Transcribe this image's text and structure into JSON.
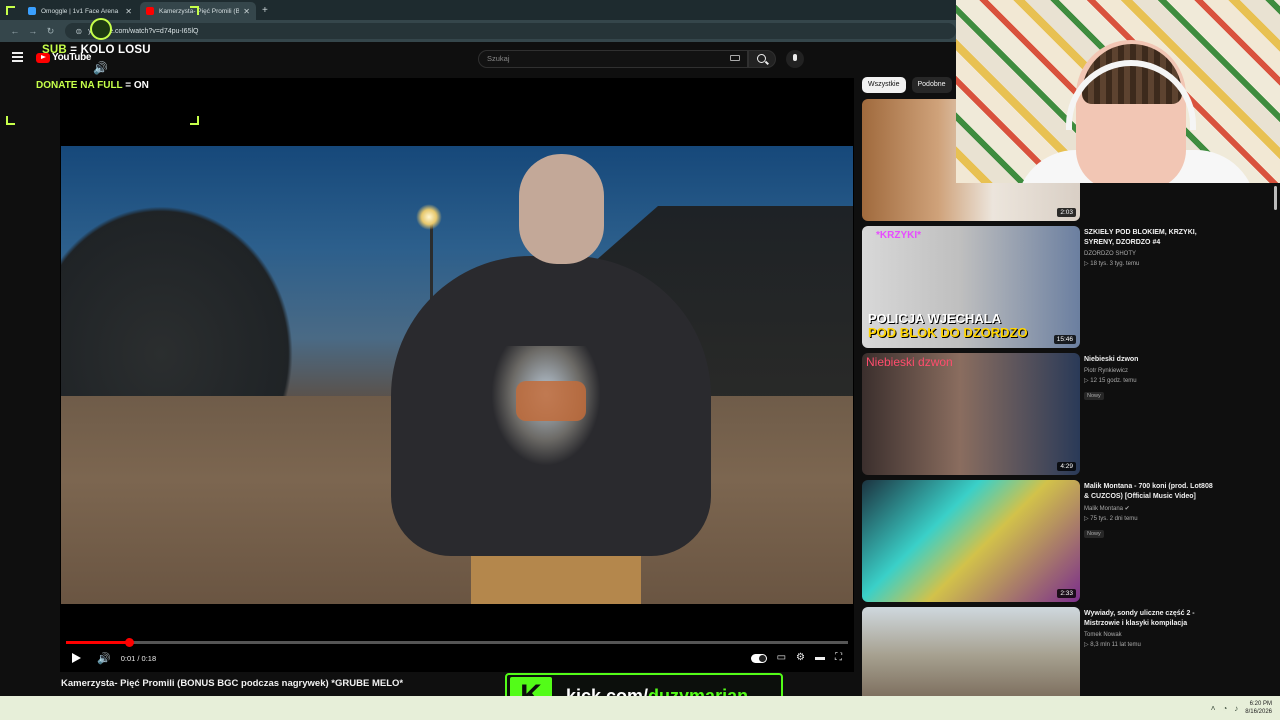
{
  "browser": {
    "tabs": [
      {
        "title": "Omoggle | 1v1 Face Arena",
        "icon": "omoggle-icon",
        "color": "#3aa0ff",
        "active": false
      },
      {
        "title": "Kamerzysta- Pięć Promili (BON",
        "icon": "youtube-icon",
        "color": "#ff0000",
        "active": true
      }
    ],
    "url": "youtube.com/watch?v=d74pu-I65lQ"
  },
  "youtube": {
    "logo_text": "YouTube",
    "search_placeholder": "Szukaj"
  },
  "overlay": {
    "sub_prefix": "SUB",
    "sub_suffix": "= KOLO LOSU",
    "donate_prefix": "DONATE NA FULL",
    "donate_suffix": "= ON",
    "accent": "#c6ff4a"
  },
  "player": {
    "progress_fraction": 0.08,
    "time": "0:01 / 0:18",
    "title": "Kamerzysta- Pięć Promili (BONUS BGC podczas nagrywek) *GRUBE MELO*"
  },
  "sidebar": {
    "chips": [
      "Wszystkie",
      "Podobne"
    ],
    "recommendations": [
      {
        "title": "",
        "channel": "",
        "meta": "",
        "badge": "",
        "duration": "2:03"
      },
      {
        "title": "SZKIEŁY POD BLOKIEM, KRZYKI, SYRENY, DZORDZO #4",
        "channel": "DZORDZO SHOTY",
        "meta": "▷ 18 tys. 3 tyg. temu",
        "badge": "",
        "duration": "15:46",
        "thumb_tag": "*KRZYKI*",
        "thumb_line1": "POLICJA WJECHALA",
        "thumb_line2": "POD BLOK DO DZORDZO"
      },
      {
        "title": "Niebieski dzwon",
        "channel": "Piotr Rynkiewicz",
        "meta": "▷ 12 15 godz. temu",
        "badge": "Nowy",
        "duration": "4:29",
        "thumb_caption": "Niebieski dzwon"
      },
      {
        "title": "Malik Montana - 700 koni (prod. Lot808 & CUZCOS) [Official Music Video]",
        "channel": "Malik Montana ✔",
        "meta": "▷ 75 tys. 2 dni temu",
        "badge": "Nowy",
        "duration": "2:33"
      },
      {
        "title": "Wywiady, sondy uliczne część 2 - Mistrzowie i klasyki kompilacja",
        "channel": "Tomek Nowak",
        "meta": "▷ 8,3 mln 11 lat temu",
        "badge": "",
        "duration": ""
      }
    ]
  },
  "kick": {
    "letter": "K",
    "prefix": "kick.com/",
    "handle": "duzymarian",
    "color": "#53fc18"
  },
  "taskbar": {
    "time": "6:20 PM",
    "date": "8/16/2026"
  }
}
